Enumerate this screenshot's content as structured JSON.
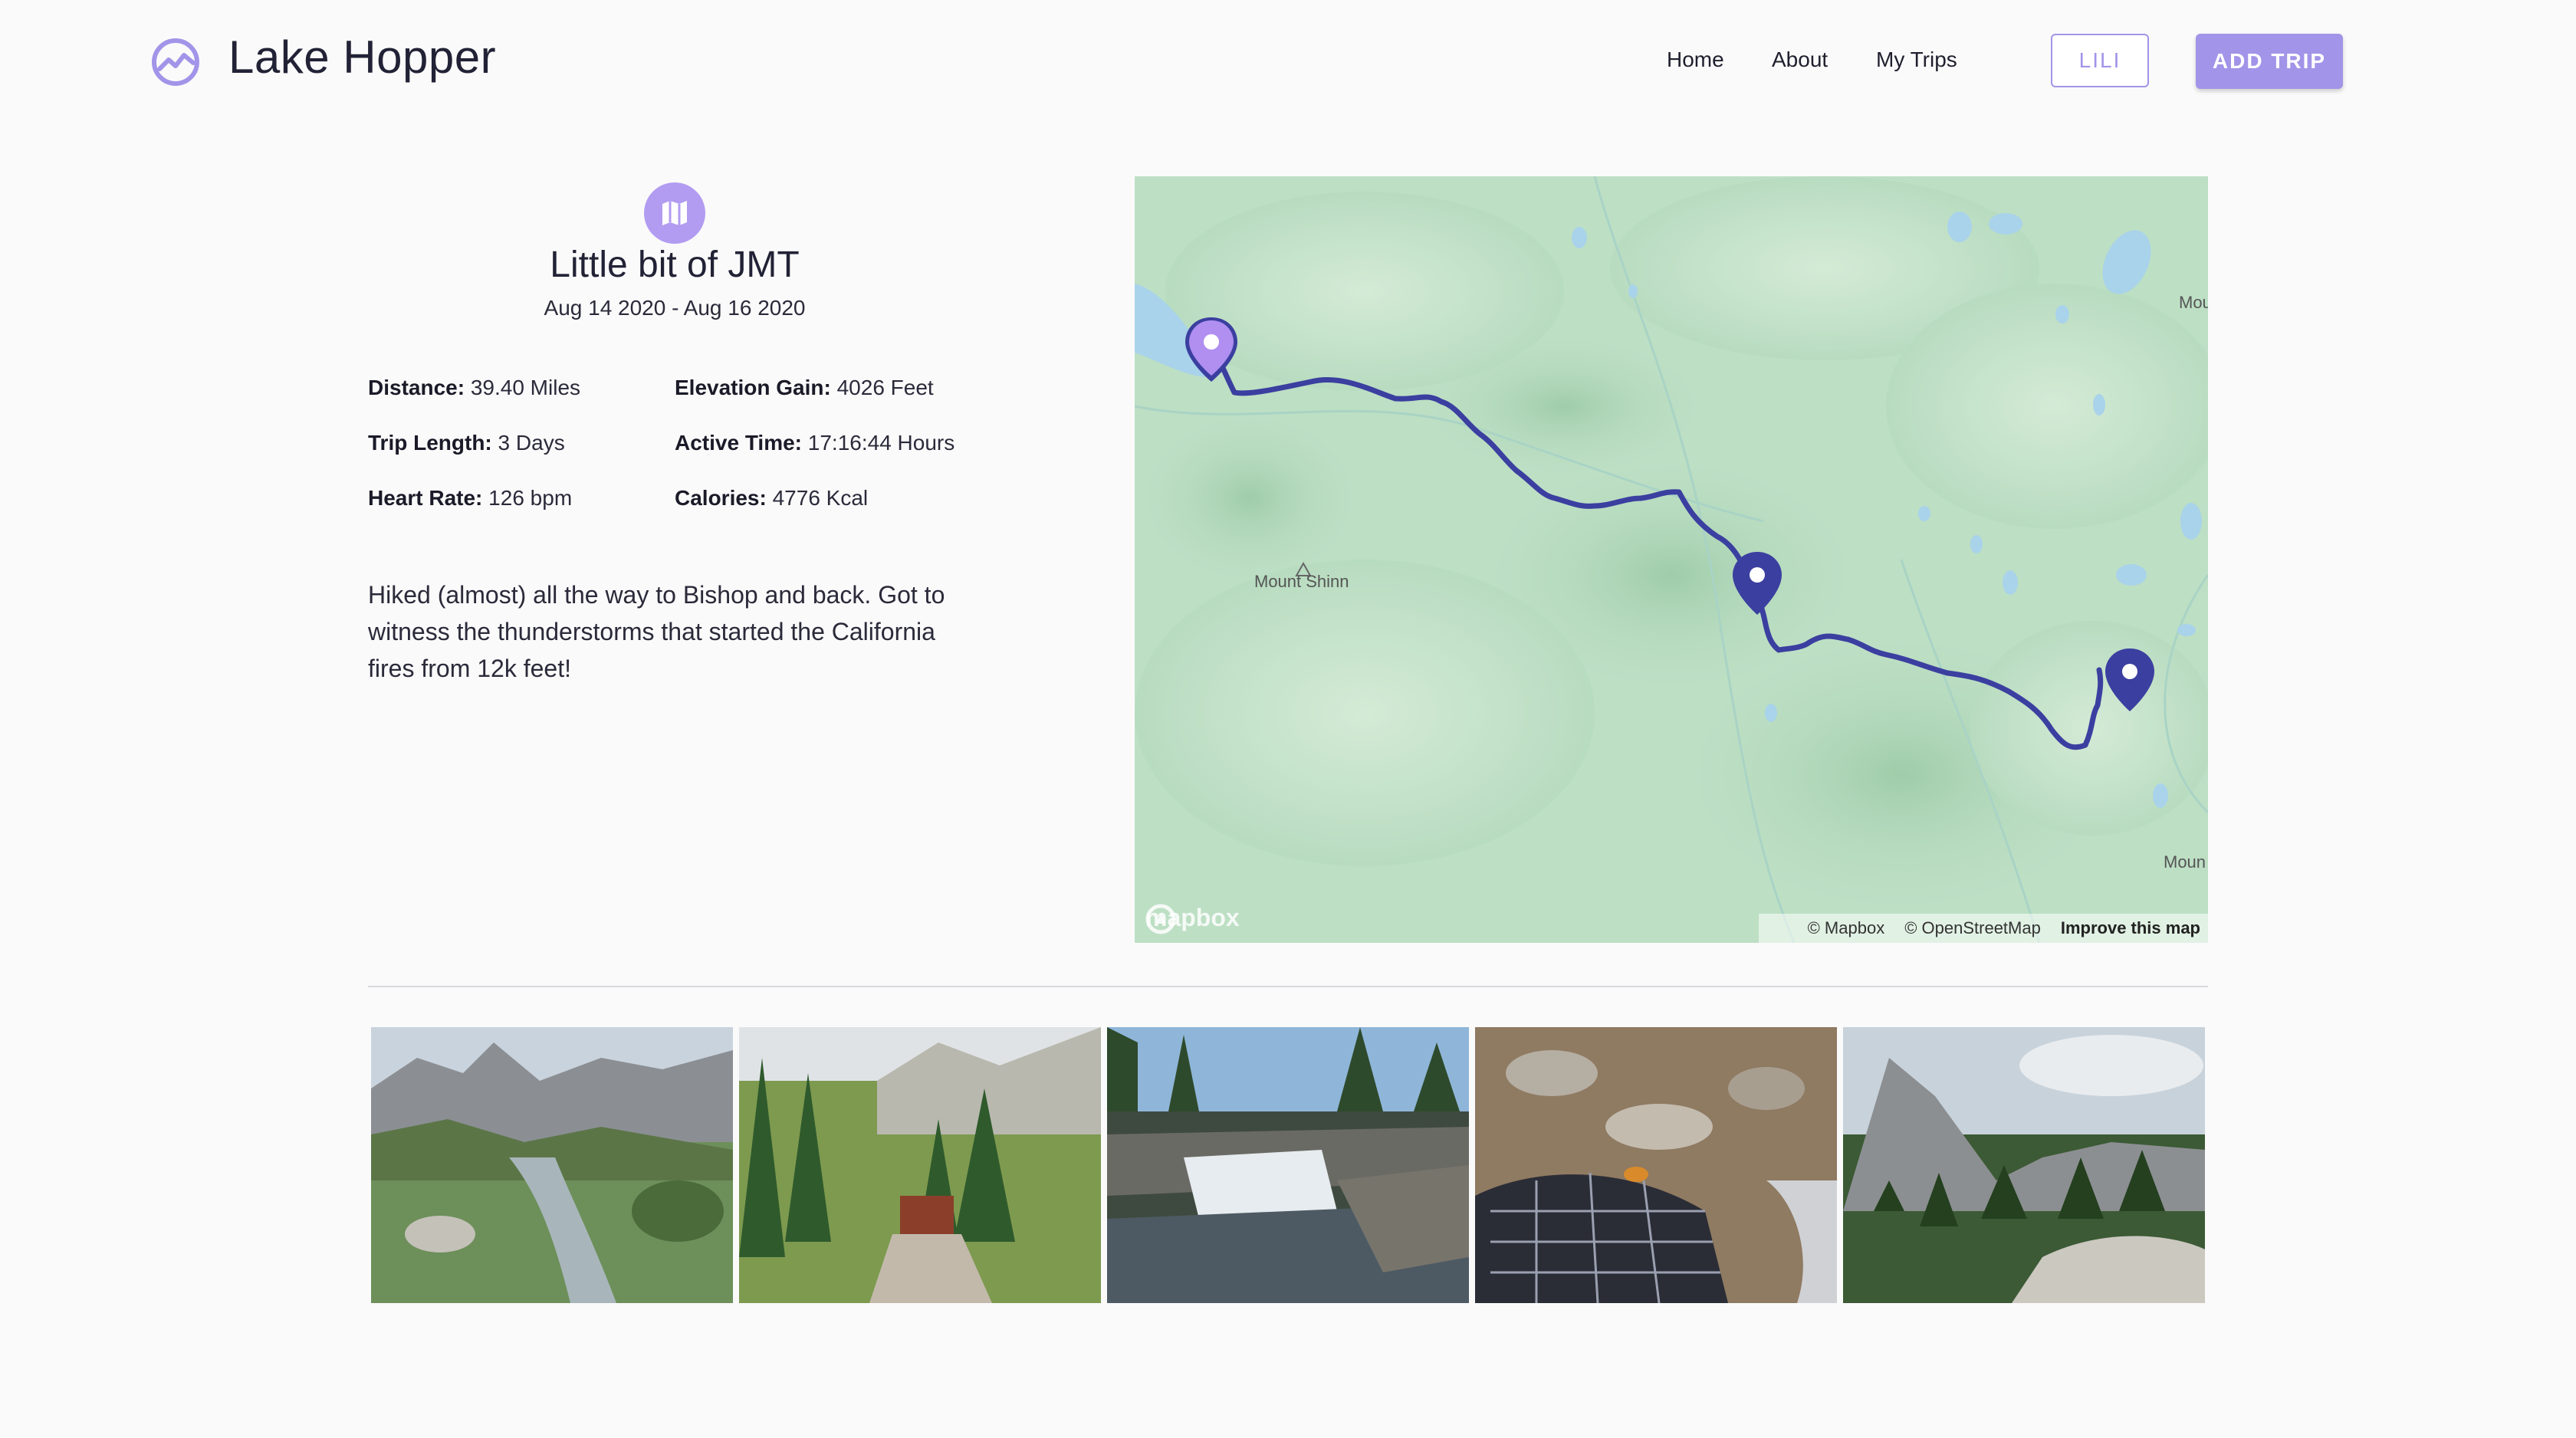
{
  "app": {
    "title": "Lake Hopper"
  },
  "nav": {
    "home": "Home",
    "about": "About",
    "my_trips": "My Trips"
  },
  "buttons": {
    "user": "LILI",
    "add_trip": "ADD TRIP"
  },
  "trip": {
    "title": "Little bit of JMT",
    "dates": "Aug 14 2020 - Aug 16 2020",
    "stats": [
      {
        "label": "Distance:",
        "value": "39.40 Miles"
      },
      {
        "label": "Elevation Gain:",
        "value": "4026 Feet"
      },
      {
        "label": "Trip Length:",
        "value": "3 Days"
      },
      {
        "label": "Active Time:",
        "value": "17:16:44 Hours"
      },
      {
        "label": "Heart Rate:",
        "value": "126 bpm"
      },
      {
        "label": "Calories:",
        "value": "4776 Kcal"
      }
    ],
    "description": "Hiked (almost) all the way to Bishop and back. Got to witness the thunderstorms that started the California fires from 12k feet!"
  },
  "map": {
    "peak_label": "Mount Shinn",
    "edge_label_top": "Mou",
    "edge_label_bottom": "Moun",
    "logo_text": "mapbox",
    "attribution": {
      "mapbox": "© Mapbox",
      "osm": "© OpenStreetMap",
      "improve": "Improve this map"
    },
    "route_color": "#3b3fa0",
    "start_marker_color": "#b08ff0",
    "marker_color": "#3b3fa0"
  },
  "photos": [
    {
      "name": "photo-mountain-valley-stream"
    },
    {
      "name": "photo-trail-bridge-forest"
    },
    {
      "name": "photo-waterfall-rocks"
    },
    {
      "name": "photo-insect-on-backpack"
    },
    {
      "name": "photo-peak-pine-forest"
    }
  ],
  "colors": {
    "accent": "#a294e8",
    "background": "#fafafa"
  }
}
